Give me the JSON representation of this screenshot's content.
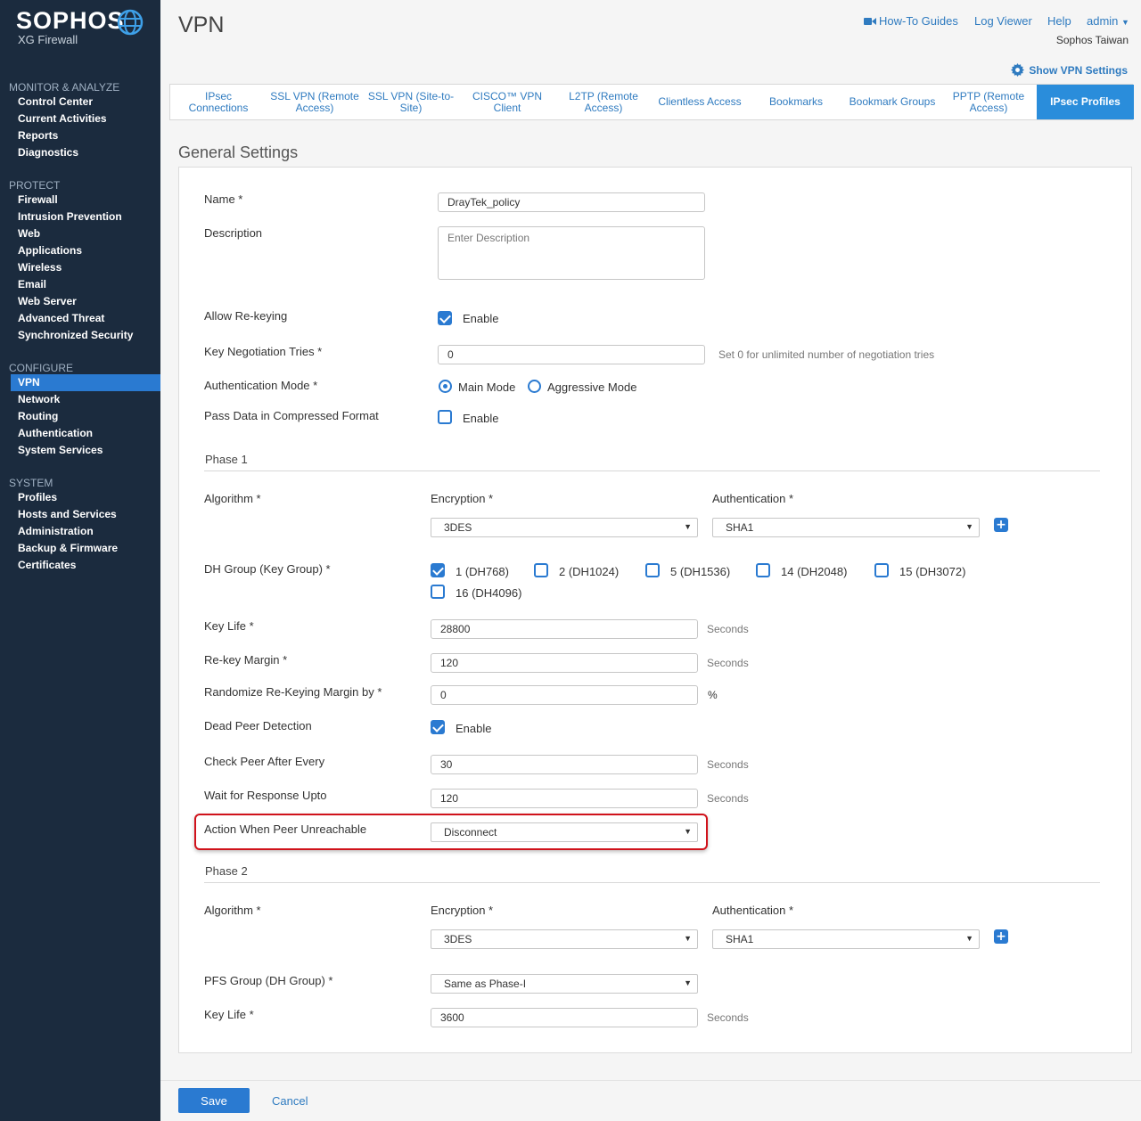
{
  "sidebar": {
    "logo": "SOPHOS",
    "product": "XG Firewall",
    "sections": [
      {
        "title": "MONITOR & ANALYZE",
        "items": [
          "Control Center",
          "Current Activities",
          "Reports",
          "Diagnostics"
        ]
      },
      {
        "title": "PROTECT",
        "items": [
          "Firewall",
          "Intrusion Prevention",
          "Web",
          "Applications",
          "Wireless",
          "Email",
          "Web Server",
          "Advanced Threat",
          "Synchronized Security"
        ]
      },
      {
        "title": "CONFIGURE",
        "items": [
          "VPN",
          "Network",
          "Routing",
          "Authentication",
          "System Services"
        ]
      },
      {
        "title": "SYSTEM",
        "items": [
          "Profiles",
          "Hosts and Services",
          "Administration",
          "Backup & Firmware",
          "Certificates"
        ]
      }
    ],
    "active_item": "VPN"
  },
  "header": {
    "title": "VPN",
    "links": {
      "howto": "How-To Guides",
      "logviewer": "Log Viewer",
      "help": "Help",
      "admin": "admin"
    },
    "org": "Sophos Taiwan",
    "show_vpn_settings": "Show VPN Settings"
  },
  "tabs": [
    "IPsec Connections",
    "SSL VPN (Remote Access)",
    "SSL VPN (Site-to-Site)",
    "CISCO™ VPN Client",
    "L2TP (Remote Access)",
    "Clientless Access",
    "Bookmarks",
    "Bookmark Groups",
    "PPTP (Remote Access)",
    "IPsec Profiles"
  ],
  "active_tab": "IPsec Profiles",
  "form": {
    "section_title": "General Settings",
    "name_label": "Name *",
    "name_value": "DrayTek_policy",
    "description_label": "Description",
    "description_placeholder": "Enter Description",
    "rekey_label": "Allow Re-keying",
    "rekey_enable": "Enable",
    "rekey_checked": true,
    "key_neg_label": "Key Negotiation Tries *",
    "key_neg_value": "0",
    "key_neg_hint": "Set 0 for unlimited number of negotiation tries",
    "auth_mode_label": "Authentication Mode *",
    "auth_mode_main": "Main Mode",
    "auth_mode_aggressive": "Aggressive Mode",
    "auth_mode_selected": "Main Mode",
    "compress_label": "Pass Data in Compressed Format",
    "compress_enable": "Enable",
    "compress_checked": false
  },
  "phase1": {
    "title": "Phase 1",
    "algorithm_label": "Algorithm *",
    "encryption_label": "Encryption *",
    "authentication_label": "Authentication *",
    "encryption_value": "3DES",
    "authentication_value": "SHA1",
    "dh_label": "DH Group (Key Group) *",
    "dh_groups": [
      {
        "label": "1 (DH768)",
        "checked": true
      },
      {
        "label": "2 (DH1024)",
        "checked": false
      },
      {
        "label": "5 (DH1536)",
        "checked": false
      },
      {
        "label": "14 (DH2048)",
        "checked": false
      },
      {
        "label": "15 (DH3072)",
        "checked": false
      },
      {
        "label": "16 (DH4096)",
        "checked": false
      }
    ],
    "key_life_label": "Key Life *",
    "key_life_value": "28800",
    "rekey_margin_label": "Re-key Margin *",
    "rekey_margin_value": "120",
    "randomize_label": "Randomize Re-Keying Margin by *",
    "randomize_value": "0",
    "randomize_unit": "%",
    "dpd_label": "Dead Peer Detection",
    "dpd_enable": "Enable",
    "dpd_checked": true,
    "check_peer_label": "Check Peer After Every",
    "check_peer_value": "30",
    "wait_label": "Wait for Response Upto",
    "wait_value": "120",
    "action_label": "Action When Peer Unreachable",
    "action_value": "Disconnect",
    "seconds": "Seconds"
  },
  "phase2": {
    "title": "Phase 2",
    "algorithm_label": "Algorithm *",
    "encryption_label": "Encryption *",
    "authentication_label": "Authentication *",
    "encryption_value": "3DES",
    "authentication_value": "SHA1",
    "pfs_label": "PFS Group (DH Group) *",
    "pfs_value": "Same as Phase-I",
    "key_life_label": "Key Life *",
    "key_life_value": "3600",
    "seconds": "Seconds"
  },
  "footer": {
    "save": "Save",
    "cancel": "Cancel"
  },
  "colors": {
    "sidebar_bg": "#1b2b3e",
    "accent": "#2a7ad1",
    "link": "#2f7bc0",
    "highlight": "#d0121b"
  }
}
